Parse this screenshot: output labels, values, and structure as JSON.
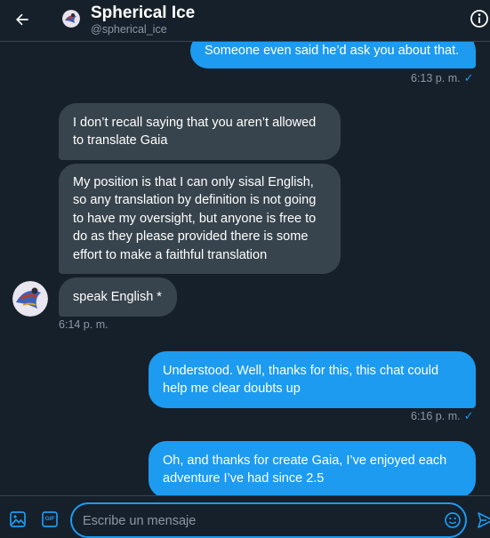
{
  "header": {
    "back_icon": "arrow-left-icon",
    "name": "Spherical Ice",
    "handle": "@spherical_ice",
    "info_icon": "info-icon"
  },
  "messages": [
    {
      "direction": "out",
      "lines": [
        "Someone even said he’d ask you about that."
      ]
    },
    {
      "direction": "in",
      "lines": [
        "I don’t recall saying that you aren’t allowed",
        "to translate Gaia"
      ]
    },
    {
      "direction": "in",
      "lines": [
        "My position is that I can only sisal English,",
        "so any translation by definition is not going",
        "to have my oversight, but anyone is free to",
        "do as they please provided there is some",
        "effort to make a faithful translation"
      ]
    },
    {
      "direction": "in",
      "lines": [
        "speak English *"
      ]
    },
    {
      "direction": "out",
      "lines": [
        "Understood. Well, thanks for this, this chat could",
        "help me clear doubts up"
      ]
    },
    {
      "direction": "out",
      "lines": [
        "Oh, and thanks for create Gaia, I’ve enjoyed each",
        "adventure I’ve had since 2.5"
      ]
    }
  ],
  "timestamps": {
    "t1": "6:13 p. m.",
    "t2": "6:14 p. m.",
    "t3": "6:16 p. m."
  },
  "composer": {
    "placeholder": "Escribe un mensaje",
    "media_icon": "image-icon",
    "gif_label": "GIF",
    "emoji_icon": "emoji-icon",
    "send_icon": "send-icon"
  },
  "colors": {
    "background": "#15202b",
    "accent": "#1d9bf0",
    "incoming_bubble": "#38444d",
    "muted_text": "#8b98a5"
  }
}
